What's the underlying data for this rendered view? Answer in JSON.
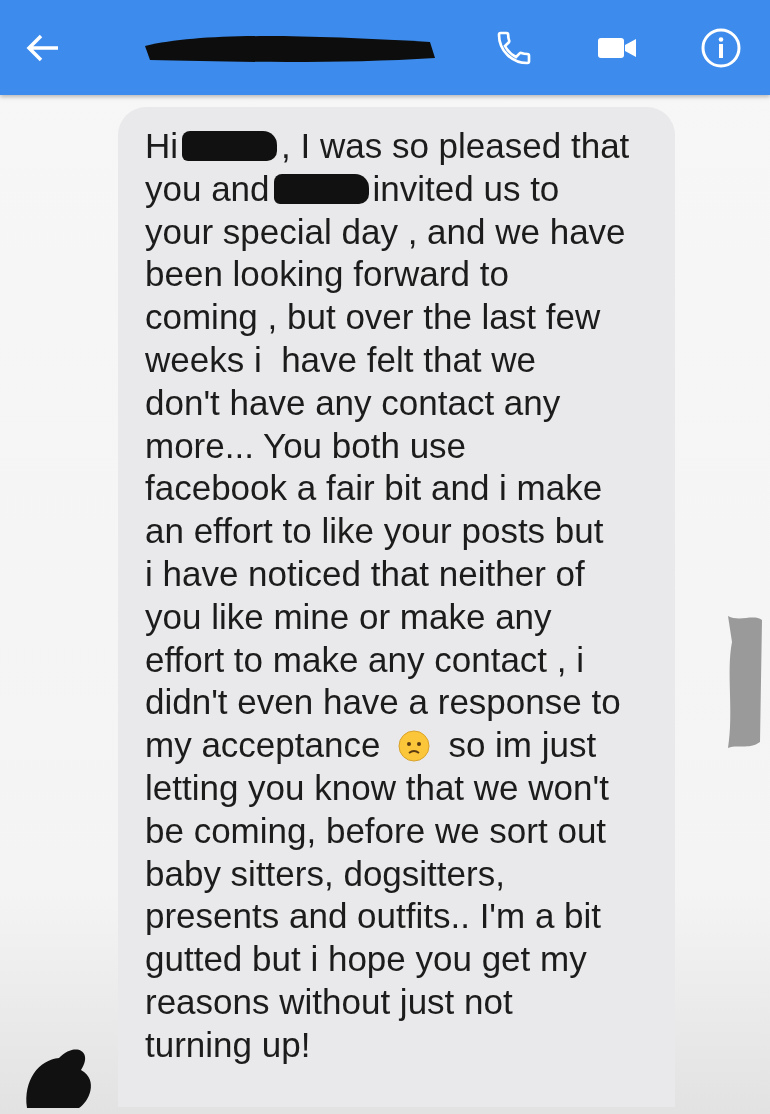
{
  "message": {
    "lines": [
      [
        {
          "kind": "text",
          "text": "Hi"
        },
        {
          "kind": "redaction"
        },
        {
          "kind": "text",
          "text": ", I was so pleased that"
        }
      ],
      [
        {
          "kind": "text",
          "text": "you and"
        },
        {
          "kind": "redaction"
        },
        {
          "kind": "text",
          "text": "invited us to"
        }
      ],
      [
        {
          "kind": "text",
          "text": "your special day , and we have"
        }
      ],
      [
        {
          "kind": "text",
          "text": "been looking forward to"
        }
      ],
      [
        {
          "kind": "text",
          "text": "coming , but over the last few"
        }
      ],
      [
        {
          "kind": "text",
          "text": "weeks i  have felt that we"
        }
      ],
      [
        {
          "kind": "text",
          "text": "don't have any contact any"
        }
      ],
      [
        {
          "kind": "text",
          "text": "more... You both use"
        }
      ],
      [
        {
          "kind": "text",
          "text": "facebook a fair bit and i make"
        }
      ],
      [
        {
          "kind": "text",
          "text": "an effort to like your posts but"
        }
      ],
      [
        {
          "kind": "text",
          "text": "i have noticed that neither of"
        }
      ],
      [
        {
          "kind": "text",
          "text": "you like mine or make any"
        }
      ],
      [
        {
          "kind": "text",
          "text": "effort to make any contact , i"
        }
      ],
      [
        {
          "kind": "text",
          "text": "didn't even have a response to"
        }
      ],
      [
        {
          "kind": "text",
          "text": "my acceptance"
        },
        {
          "kind": "emoji"
        },
        {
          "kind": "text",
          "text": "so im just"
        }
      ],
      [
        {
          "kind": "text",
          "text": "letting you know that we won't"
        }
      ],
      [
        {
          "kind": "text",
          "text": "be coming, before we sort out"
        }
      ],
      [
        {
          "kind": "text",
          "text": "baby sitters, dogsitters,"
        }
      ],
      [
        {
          "kind": "text",
          "text": "presents and outfits.. I'm a bit"
        }
      ],
      [
        {
          "kind": "text",
          "text": "gutted but i hope you get my"
        }
      ],
      [
        {
          "kind": "text",
          "text": "reasons without just not"
        }
      ],
      [
        {
          "kind": "text",
          "text": "turning up!"
        }
      ]
    ]
  }
}
